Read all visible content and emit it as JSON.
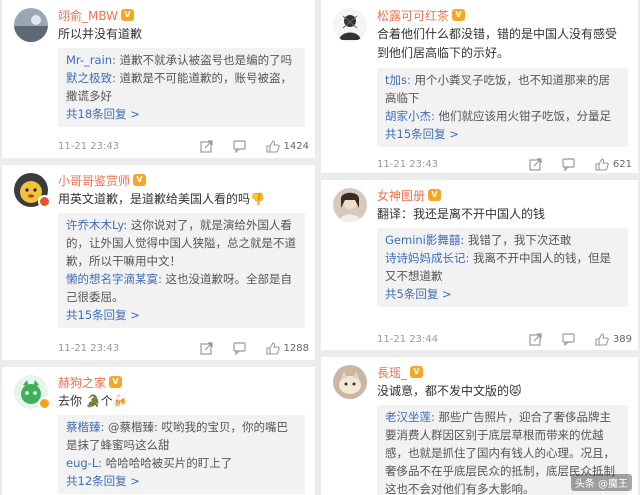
{
  "comments": [
    {
      "username": "翊俞_MBW",
      "badge": "V",
      "text": "所以并没有道歉",
      "replies": [
        {
          "user": "Mr-_rain:",
          "text": " 道歉不就承认被盗号也是编的了吗"
        },
        {
          "user": "默之极致:",
          "text": " 道歉是不可能道歉的，账号被盗，撒谎多好"
        }
      ],
      "more": "共18条回复 >",
      "time": "11-21 23:43",
      "likes": "1424"
    },
    {
      "username": "小哥哥鉴赏师",
      "badge": "V",
      "text": "用英文道歉，是道歉给美国人看的吗👎",
      "replies": [
        {
          "user": "许乔木木Ly:",
          "text": " 这你说对了，就是演给外国人看的，让外国人觉得中国人狭隘，总之就是不道歉，所以干嘛用中文！"
        },
        {
          "user": "懒的想名字滴某寞:",
          "text": " 这也没道歉呀。全部是自己很委屈。"
        }
      ],
      "more": "共15条回复 >",
      "time": "11-21 23:43",
      "likes": "1288"
    },
    {
      "username": "赫狗之家",
      "badge": "V",
      "text": "去你 🐊个🍻",
      "replies": [
        {
          "user": "蔡楷臻:",
          "text": " @蔡楷臻: 哎哟我的宝贝，你的嘴巴是抹了蜂蜜吗这么甜"
        },
        {
          "user": "eug-L:",
          "text": " 哈哈哈哈被买片的盯上了"
        }
      ],
      "more": "共12条回复 >",
      "time": "",
      "likes": ""
    },
    {
      "username": "松露可可红茶",
      "badge": "V",
      "text": "合着他们什么都没错，错的是中国人没有感受到他们居高临下的示好。",
      "replies": [
        {
          "user": "t加s:",
          "text": " 用个小粪叉子吃饭，也不知道那来的居高临下"
        },
        {
          "user": "胡家小杰:",
          "text": " 他们就应该用火钳子吃饭，分量足"
        }
      ],
      "more": "共15条回复 >",
      "time": "11-21 23:43",
      "likes": "621"
    },
    {
      "username": "女神图册",
      "badge": "V",
      "text": "翻译：我还是离不开中国人的钱",
      "replies": [
        {
          "user": "Gemini影舞囍:",
          "text": " 我错了，我下次还敢"
        },
        {
          "user": "诗诗妈妈成长记:",
          "text": " 我离不开中国人的钱，但是又不想道歉"
        }
      ],
      "more": "共5条回复 >",
      "time": "11-21 23:44",
      "likes": "389"
    },
    {
      "username": "長瑶_",
      "badge": "V",
      "text": "没诚意，都不发中文版的😾",
      "replies": [
        {
          "user": "老汉坐莲:",
          "text": " 那些广告照片，迎合了奢侈品牌主要消费人群因区别于底层草根而带来的优越感，也就是抓住了国内有钱人的心理。况且，奢侈品不在乎底层民众的抵制，底层民众抵制这也不会对他们有多大影响。"
        }
      ],
      "more": "",
      "time": "",
      "likes": ""
    }
  ],
  "watermark": "头条 @魔王"
}
